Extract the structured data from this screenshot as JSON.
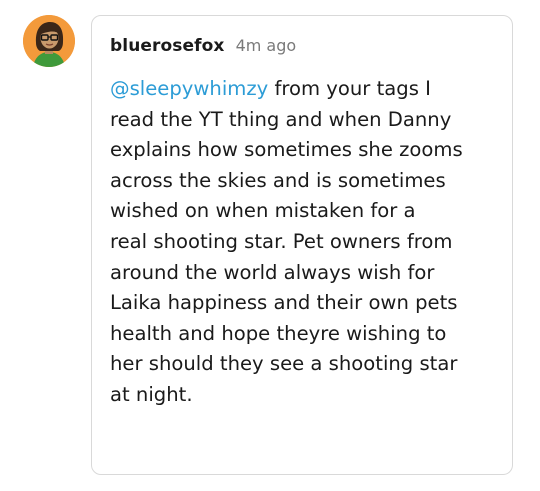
{
  "avatar": {
    "icon": "user-avatar-icon",
    "background": "#f39a3b"
  },
  "comment": {
    "username": "bluerosefox",
    "timestamp": "4m ago",
    "mention": "@sleepywhimzy",
    "text_first_line_rest": " from your tags I",
    "lines": [
      "read the YT thing and when Danny",
      "explains how sometimes she zooms",
      "across the skies and is sometimes",
      "wished on when mistaken for a",
      "real shooting star. Pet owners from",
      "around the world always wish for",
      "Laika happiness and their own pets",
      "health and hope theyre wishing to",
      "her should they see a shooting star",
      "at night."
    ]
  },
  "colors": {
    "mention": "#2c9cd6",
    "text": "#1a1a1a",
    "timestamp": "#7a7a7a",
    "border": "#d9d9d9"
  }
}
